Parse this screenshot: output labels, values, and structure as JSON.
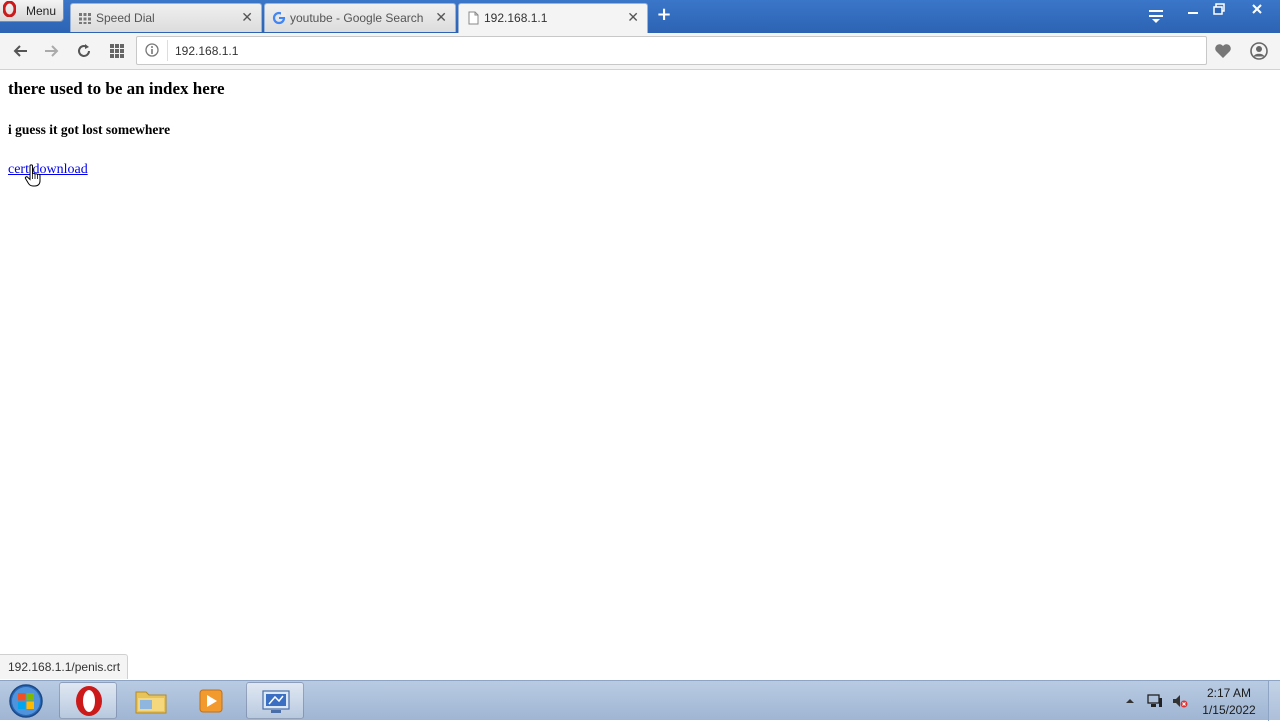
{
  "browser": {
    "menu_label": "Menu",
    "tabs": [
      {
        "label": "Speed Dial",
        "icon": "speed-dial-icon",
        "close": "✕"
      },
      {
        "label": "youtube - Google Search",
        "icon": "google-icon",
        "close": "✕"
      },
      {
        "label": "192.168.1.1",
        "icon": "page-icon",
        "close": "✕"
      }
    ],
    "new_tab": "+",
    "address": "192.168.1.1",
    "status_url": "192.168.1.1/penis.crt"
  },
  "page": {
    "heading": "there used to be an index here",
    "subheading": "i guess it got lost somewhere",
    "link_text": "cert download"
  },
  "taskbar": {
    "time": "2:17 AM",
    "date": "1/15/2022"
  },
  "colors": {
    "tabbar": "#2d63b3",
    "link": "#0000ee",
    "opera_red": "#cc1a1a"
  }
}
